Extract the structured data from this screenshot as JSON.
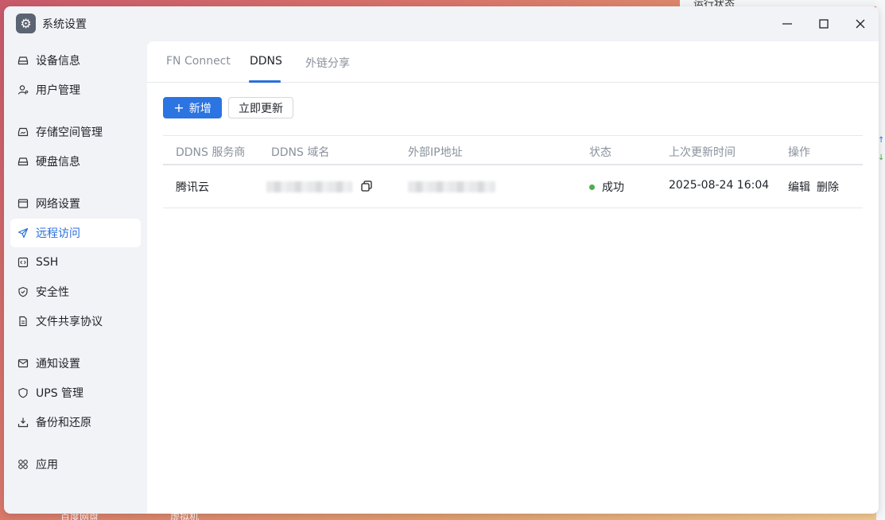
{
  "background": {
    "right_panel_title": "运行状态",
    "bottom_labels": [
      "百度网盘",
      "虚拟机"
    ]
  },
  "window": {
    "title": "系统设置",
    "controls": {
      "minimize": "—",
      "maximize": "☐",
      "close": "✕"
    }
  },
  "sidebar": {
    "items": [
      {
        "label": "设备信息",
        "icon": "drive-icon"
      },
      {
        "label": "用户管理",
        "icon": "user-icon"
      },
      {
        "label": "存储空间管理",
        "icon": "storage-icon"
      },
      {
        "label": "硬盘信息",
        "icon": "disk-icon"
      },
      {
        "label": "网络设置",
        "icon": "network-icon"
      },
      {
        "label": "远程访问",
        "icon": "send-icon",
        "active": true
      },
      {
        "label": "SSH",
        "icon": "code-icon"
      },
      {
        "label": "安全性",
        "icon": "shield-icon"
      },
      {
        "label": "文件共享协议",
        "icon": "file-icon"
      },
      {
        "label": "通知设置",
        "icon": "mail-icon"
      },
      {
        "label": "UPS 管理",
        "icon": "ups-shield-icon"
      },
      {
        "label": "备份和还原",
        "icon": "backup-icon"
      },
      {
        "label": "应用",
        "icon": "apps-icon"
      }
    ]
  },
  "tabs": [
    {
      "label": "FN Connect"
    },
    {
      "label": "DDNS",
      "active": true
    },
    {
      "label": "外链分享"
    }
  ],
  "toolbar": {
    "add_label": "新增",
    "update_label": "立即更新"
  },
  "table": {
    "columns": [
      "DDNS 服务商",
      "DDNS 域名",
      "外部IP地址",
      "状态",
      "上次更新时间",
      "操作"
    ],
    "rows": [
      {
        "provider": "腾讯云",
        "domain": "",
        "ip": "",
        "status": "成功",
        "updated": "2025-08-24 16:04",
        "edit": "编辑",
        "delete": "删除"
      }
    ]
  },
  "colors": {
    "accent": "#2b74e2",
    "status_success": "#4caf50"
  }
}
